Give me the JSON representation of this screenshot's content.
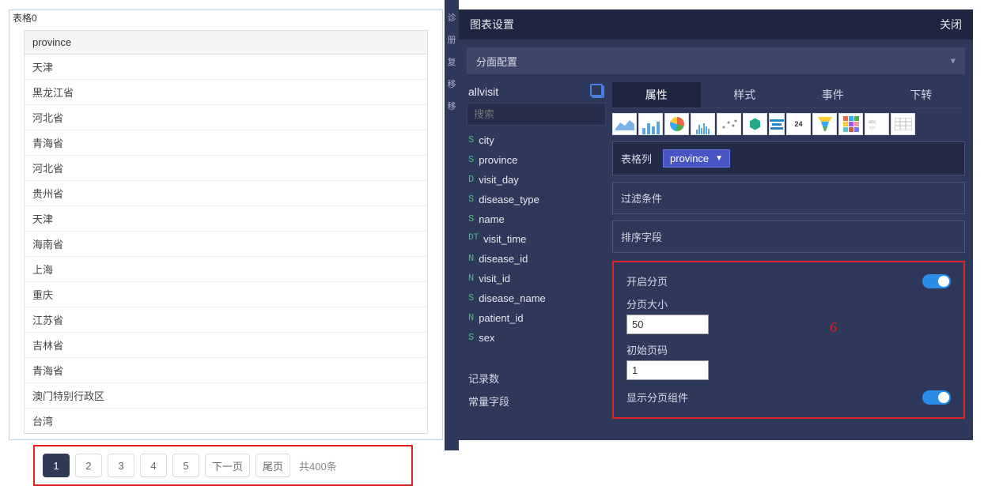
{
  "left": {
    "title": "表格0",
    "header": "province",
    "rows": [
      "天津",
      "黑龙江省",
      "河北省",
      "青海省",
      "河北省",
      "贵州省",
      "天津",
      "海南省",
      "上海",
      "重庆",
      "江苏省",
      "吉林省",
      "青海省",
      "澳门特别行政区",
      "台湾"
    ],
    "pages": [
      "1",
      "2",
      "3",
      "4",
      "5"
    ],
    "active_page": "1",
    "next": "下一页",
    "last": "尾页",
    "total": "共400条"
  },
  "mid": {
    "items": [
      "诊",
      "册",
      "复",
      "移",
      "移"
    ]
  },
  "right": {
    "title": "图表设置",
    "close": "关闭",
    "facet": "分面配置",
    "datasource": "allvisit",
    "search_placeholder": "搜索",
    "fields": [
      {
        "t": "S",
        "n": "city"
      },
      {
        "t": "S",
        "n": "province"
      },
      {
        "t": "D",
        "n": "visit_day"
      },
      {
        "t": "S",
        "n": "disease_type"
      },
      {
        "t": "S",
        "n": "name"
      },
      {
        "t": "DT",
        "n": "visit_time"
      },
      {
        "t": "N",
        "n": "disease_id"
      },
      {
        "t": "N",
        "n": "visit_id"
      },
      {
        "t": "S",
        "n": "disease_name"
      },
      {
        "t": "N",
        "n": "patient_id"
      },
      {
        "t": "S",
        "n": "sex"
      }
    ],
    "extras": [
      "记录数",
      "常量字段"
    ],
    "tabs": [
      "属性",
      "样式",
      "事件",
      "下转"
    ],
    "active_tab": "属性",
    "chart_number_icon": "24",
    "table_col_label": "表格列",
    "table_col_value": "province",
    "filter_label": "过滤条件",
    "sort_label": "排序字段",
    "paging": {
      "enable": "开启分页",
      "size_label": "分页大小",
      "size_value": "50",
      "init_label": "初始页码",
      "init_value": "1",
      "show_widget": "显示分页组件",
      "annotation": "6"
    }
  }
}
